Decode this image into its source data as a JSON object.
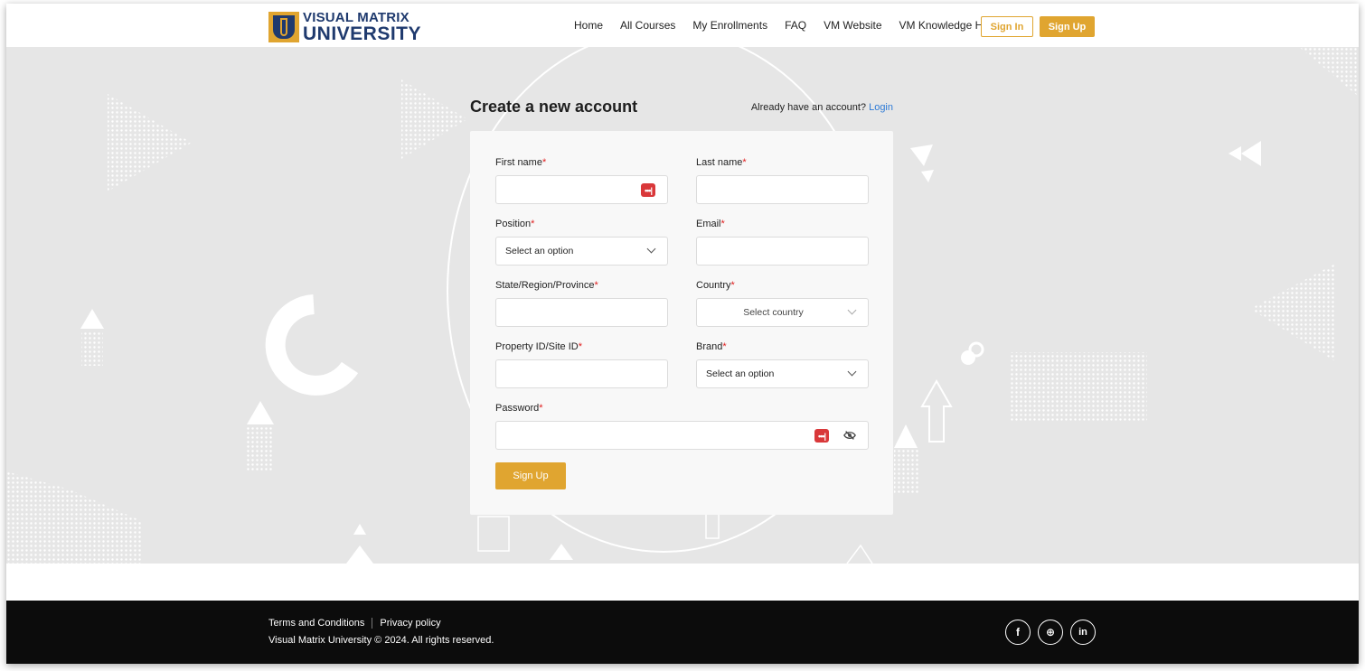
{
  "brand": {
    "line1": "VISUAL MATRIX",
    "line2": "UNIVERSITY",
    "color_primary": "#1f3a6e",
    "color_accent": "#e0a530"
  },
  "nav": {
    "items": [
      "Home",
      "All Courses",
      "My Enrollments",
      "FAQ",
      "VM Website",
      "VM Knowledge Hub"
    ],
    "sign_in": "Sign In",
    "sign_up": "Sign Up"
  },
  "form": {
    "title": "Create a new account",
    "already_text": "Already have an account?",
    "login_link": "Login",
    "required_mark": "*",
    "fields": {
      "first_name": {
        "label": "First name",
        "value": ""
      },
      "last_name": {
        "label": "Last name",
        "value": ""
      },
      "position": {
        "label": "Position",
        "selected": "Select an option"
      },
      "email": {
        "label": "Email",
        "value": ""
      },
      "state": {
        "label": "State/Region/Province",
        "value": ""
      },
      "country": {
        "label": "Country",
        "selected": "Select country"
      },
      "property_id": {
        "label": "Property ID/Site ID",
        "value": ""
      },
      "brand": {
        "label": "Brand",
        "selected": "Select an option"
      },
      "password": {
        "label": "Password",
        "value": ""
      }
    },
    "password_manager_icon": "password-manager-icon",
    "visibility_icon": "eye-off-icon",
    "submit": "Sign Up"
  },
  "footer": {
    "terms": "Terms and Conditions",
    "privacy": "Privacy policy",
    "copyright": "Visual Matrix University © 2024. All rights reserved.",
    "socials": [
      {
        "name": "facebook-icon",
        "glyph": "f"
      },
      {
        "name": "website-icon",
        "glyph": "⊕"
      },
      {
        "name": "linkedin-icon",
        "glyph": "in"
      }
    ]
  }
}
